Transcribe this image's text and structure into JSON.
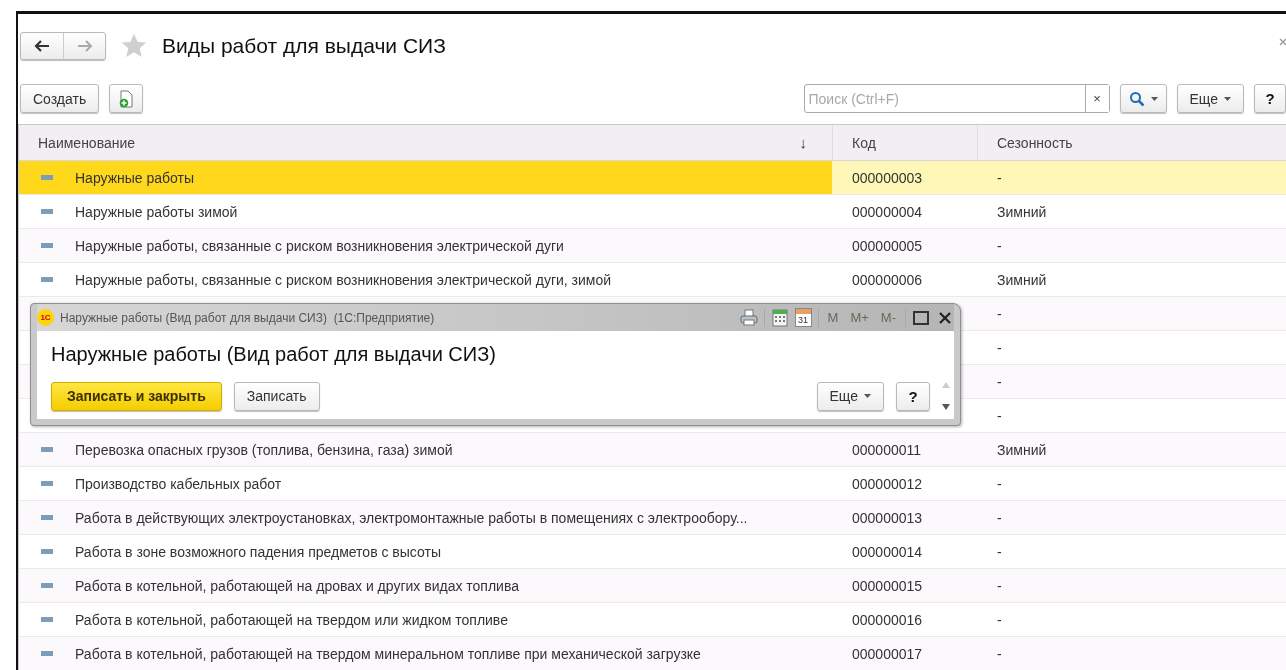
{
  "window": {
    "title": "Виды работ для выдачи СИЗ",
    "favorite": false
  },
  "toolbar": {
    "create_button": "Создать",
    "search": {
      "placeholder": "Поиск (Ctrl+F)"
    },
    "clear_button": "×",
    "more_button": "Еще",
    "help_button": "?"
  },
  "table": {
    "columns": [
      {
        "label": "Наименование",
        "sort_mark": "↓"
      },
      {
        "label": "Код"
      },
      {
        "label": "Сезонность"
      }
    ],
    "rows": [
      {
        "name": "Наружные работы",
        "code": "000000003",
        "season": "-",
        "selected": true
      },
      {
        "name": "Наружные работы зимой",
        "code": "000000004",
        "season": "Зимний",
        "selected": false
      },
      {
        "name": "Наружные работы, связанные с риском возникновения электрической дуги",
        "code": "000000005",
        "season": "-",
        "selected": false
      },
      {
        "name": "Наружные работы, связанные с риском возникновения электрической дуги, зимой",
        "code": "000000006",
        "season": "Зимний",
        "selected": false
      },
      {
        "season": "-",
        "selected": false
      },
      {
        "season": "-",
        "selected": false
      },
      {
        "season": "-",
        "selected": false
      },
      {
        "season": "-",
        "selected": false
      },
      {
        "name": "Перевозка опасных грузов (топлива, бензина, газа) зимой",
        "code": "000000011",
        "season": "Зимний",
        "selected": false
      },
      {
        "name": "Производство кабельных работ",
        "code": "000000012",
        "season": "-",
        "selected": false
      },
      {
        "name": "Работа в действующих электроустановках, электромонтажные работы в помещениях с электрообору...",
        "code": "000000013",
        "season": "-",
        "selected": false
      },
      {
        "name": "Работа в зоне возможного падения предметов с высоты",
        "code": "000000014",
        "season": "-",
        "selected": false
      },
      {
        "name": "Работа в котельной, работающей на дровах и других видах топлива",
        "code": "000000015",
        "season": "-",
        "selected": false
      },
      {
        "name": "Работа в котельной, работающей на твердом или жидком топливе",
        "code": "000000016",
        "season": "-",
        "selected": false
      },
      {
        "name": "Работа в котельной, работающей на твердом минеральном топливе при механической загрузке",
        "code": "000000017",
        "season": "-",
        "selected": false
      }
    ]
  },
  "popup": {
    "logo": "1С",
    "title": "Наружные работы (Вид работ для выдачи СИЗ)  (1С:Предприятие)",
    "calendar_day": "31",
    "memory_buttons": [
      {
        "label": "M",
        "disabled": true
      },
      {
        "label": "M+",
        "disabled": true
      },
      {
        "label": "M-",
        "disabled": true
      }
    ],
    "heading": "Наружные работы (Вид работ для выдачи СИЗ)",
    "buttons": [
      {
        "label": "Записать и закрыть",
        "kind": "default"
      },
      {
        "label": "Записать",
        "kind": "plain"
      }
    ],
    "more_button": "Еще",
    "help_button": "?"
  }
}
